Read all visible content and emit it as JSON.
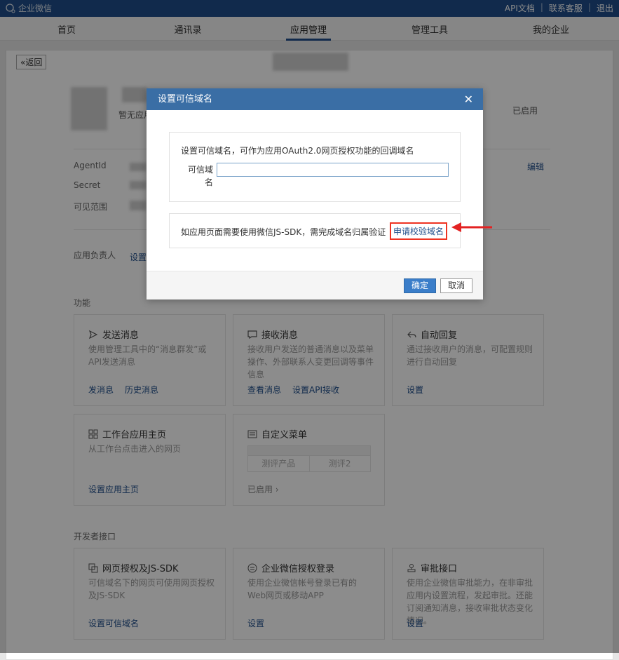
{
  "topbar": {
    "logo_text": "企业微信",
    "links": [
      "API文档",
      "联系客服",
      "退出"
    ]
  },
  "nav": {
    "items": [
      "首页",
      "通讯录",
      "应用管理",
      "管理工具",
      "我的企业"
    ],
    "active_index": 2
  },
  "page": {
    "back_label": "«返回",
    "status_right": "已启用",
    "no_app_label": "暂无应用",
    "agentid_label": "AgentId",
    "secret_label": "Secret",
    "visible_label": "可见范围",
    "edit_label": "编辑",
    "owner_label": "应用负责人",
    "owner_value": "设置",
    "section_functions": "功能",
    "section_dev": "开发者接口"
  },
  "cards": {
    "send": {
      "title": "发送消息",
      "desc": "使用管理工具中的“消息群发”或API发送消息",
      "actions": [
        "发消息",
        "历史消息"
      ]
    },
    "receive": {
      "title": "接收消息",
      "desc": "接收用户发送的普通消息以及菜单操作、外部联系人变更回调等事件信息",
      "actions": [
        "查看消息",
        "设置API接收"
      ]
    },
    "autoreply": {
      "title": "自动回复",
      "desc": "通过接收用户的消息，可配置规则进行自动回复",
      "actions": [
        "设置"
      ]
    },
    "workbench": {
      "title": "工作台应用主页",
      "desc": "从工作台点击进入的网页",
      "actions": [
        "设置应用主页"
      ]
    },
    "menu": {
      "title": "自定义菜单",
      "cells": [
        "测评产品",
        "测评2"
      ],
      "actions": [
        "已启用 ›"
      ]
    },
    "webauth": {
      "title": "网页授权及JS-SDK",
      "desc": "可信域名下的网页可使用网页授权及JS-SDK",
      "actions": [
        "设置可信域名"
      ]
    },
    "login": {
      "title": "企业微信授权登录",
      "desc": "使用企业微信帐号登录已有的Web网页或移动APP",
      "actions": [
        "设置"
      ]
    },
    "approval": {
      "title": "审批接口",
      "desc": "使用企业微信审批能力，在非审批应用内设置流程，发起审批。还能订阅通知消息，接收审批状态变化情况。",
      "actions": [
        "设置"
      ]
    }
  },
  "dialog": {
    "title": "设置可信域名",
    "close_label": "✕",
    "description": "设置可信域名，可作为应用OAuth2.0网页授权功能的回调域名",
    "field_label": "可信域名",
    "field_value": "",
    "jssdk_msg": "如应用页面需要使用微信JS-SDK，需完成域名归属验证",
    "apply_link": "申请校验域名",
    "ok_label": "确定",
    "cancel_label": "取消"
  },
  "colors": {
    "topbar": "#1f4e8a",
    "dialog_header": "#3a6ea5",
    "highlight": "#e32222",
    "link": "#1f4e8a"
  }
}
